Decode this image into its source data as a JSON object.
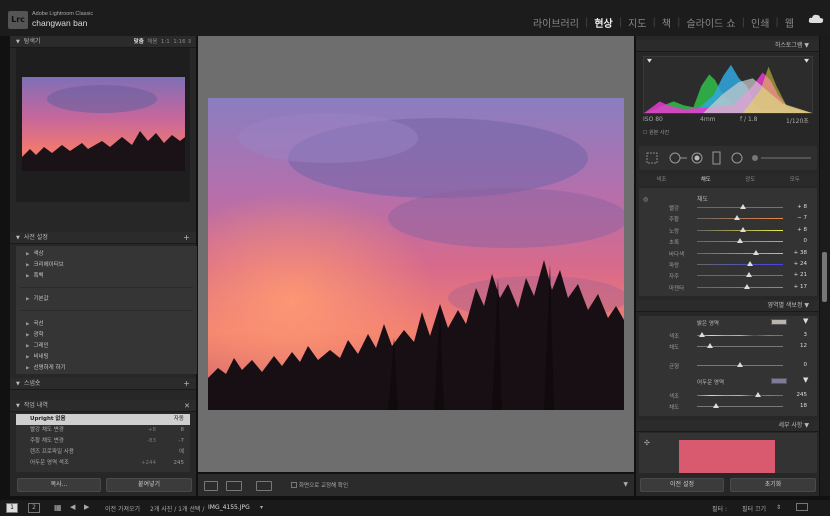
{
  "app": {
    "logo": "Lrc",
    "product": "Adobe Lightroom Classic",
    "user": "changwan ban"
  },
  "modules": [
    "라이브러리",
    "현상",
    "지도",
    "책",
    "슬라이드 쇼",
    "인쇄",
    "웹"
  ],
  "active_module": "현상",
  "navigator": {
    "title": "탐색기",
    "fit": "맞춤",
    "fill": "채움",
    "ratio1": "1:1",
    "ratio2": "1:16"
  },
  "presets": {
    "title": "사전 설정",
    "items": [
      "색상",
      "크리에이티브",
      "흑백"
    ],
    "default": "기본값",
    "items2": [
      "곡선",
      "광학",
      "그레인",
      "비네팅",
      "선명하게 하기"
    ]
  },
  "snapshots": {
    "title": "스냅숏"
  },
  "history": {
    "title": "작업 내역",
    "rows": [
      {
        "label": "Upright 없음",
        "a": "",
        "b": "자동"
      },
      {
        "label": "빨강 채도 변경",
        "a": "+8",
        "b": "8"
      },
      {
        "label": "주황 채도 변경",
        "a": "-83",
        "b": "-7"
      },
      {
        "label": "렌즈 프로파일 사용",
        "a": "",
        "b": "예"
      },
      {
        "label": "어두운 영역 색조",
        "a": "+244",
        "b": "245"
      }
    ]
  },
  "left_buttons": {
    "copy": "복사...",
    "paste": "붙여넣기"
  },
  "toolbar": {
    "softproof_label": "화면으로 교정해 확인"
  },
  "right": {
    "histogram_title": "히스토그램",
    "iso": "ISO 80",
    "focal": "4mm",
    "aperture": "f / 1.8",
    "shutter": "1/120초",
    "original_photo": "원본 사진",
    "hsl_tabs": [
      "색조",
      "채도",
      "광도",
      "모두"
    ],
    "hsl_active": "채도",
    "hsl_section": "채도",
    "hsl_rows": [
      {
        "label": "빨강",
        "value": "+ 8",
        "pos": 0.54
      },
      {
        "label": "주황",
        "value": "− 7",
        "pos": 0.46
      },
      {
        "label": "노랑",
        "value": "+ 8",
        "pos": 0.54
      },
      {
        "label": "초록",
        "value": "0",
        "pos": 0.5
      },
      {
        "label": "바다색",
        "value": "+ 38",
        "pos": 0.69
      },
      {
        "label": "파랑",
        "value": "+ 24",
        "pos": 0.62
      },
      {
        "label": "자주",
        "value": "+ 21",
        "pos": 0.6
      },
      {
        "label": "마젠타",
        "value": "+ 17",
        "pos": 0.58
      }
    ],
    "split_title": "영역별 색보정",
    "highlights": "밝은 영역",
    "hl_hue_label": "색조",
    "hl_hue": "3",
    "hl_sat_label": "채도",
    "hl_sat": "12",
    "balance_label": "균형",
    "balance": "0",
    "shadows": "어두운 영역",
    "sh_hue_label": "색조",
    "sh_hue": "245",
    "sh_sat_label": "채도",
    "sh_sat": "18",
    "detail_title": "세부 사항",
    "prev_button": "이전 설정",
    "reset_button": "초기화"
  },
  "bottom": {
    "page1": "1",
    "page2": "2",
    "import_label": "이전 가져오기",
    "count": "2개 사진 / 1개 선택 /",
    "filename": "IMG_4155.JPG",
    "filter_label": "필터 :",
    "filter_value": "필터 끄기"
  },
  "colors": {
    "sky_top": "#7a6fb0",
    "sky_mid": "#c7628e",
    "sky_low": "#f07a6e"
  }
}
